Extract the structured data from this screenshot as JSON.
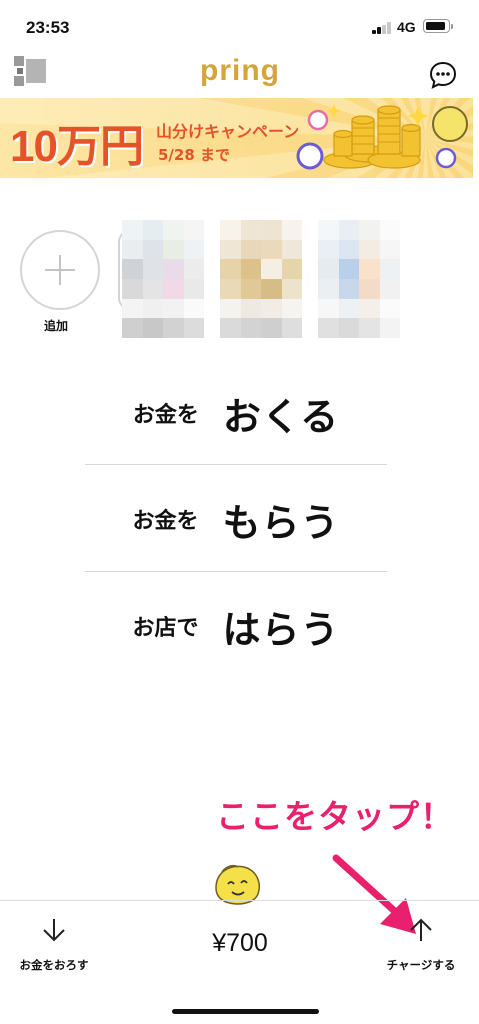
{
  "status_bar": {
    "time": "23:53",
    "network": "4G"
  },
  "header": {
    "logo": "pring",
    "logo_color": "#d4a53d",
    "left_icon": "qr-code-icon",
    "right_icon": "chat-bubble-icon"
  },
  "banner": {
    "amount": "10万円",
    "campaign": "山分けキャンペーン",
    "date": "5/28 まで",
    "accent_color": "#e5532a"
  },
  "contacts": {
    "add_label": "追加",
    "add_icon": "plus-icon"
  },
  "actions": [
    {
      "small": "お金を",
      "big": "おくる"
    },
    {
      "small": "お金を",
      "big": "もらう"
    },
    {
      "small": "お店で",
      "big": "はらう"
    }
  ],
  "annotation": {
    "text": "ここをタップ！",
    "color": "#e8206e"
  },
  "bottom_bar": {
    "withdraw_label": "お金をおろす",
    "withdraw_icon": "arrow-down-icon",
    "balance": "¥700",
    "charge_label": "チャージする",
    "charge_icon": "arrow-up-icon",
    "mascot_icon": "mascot-icon"
  }
}
